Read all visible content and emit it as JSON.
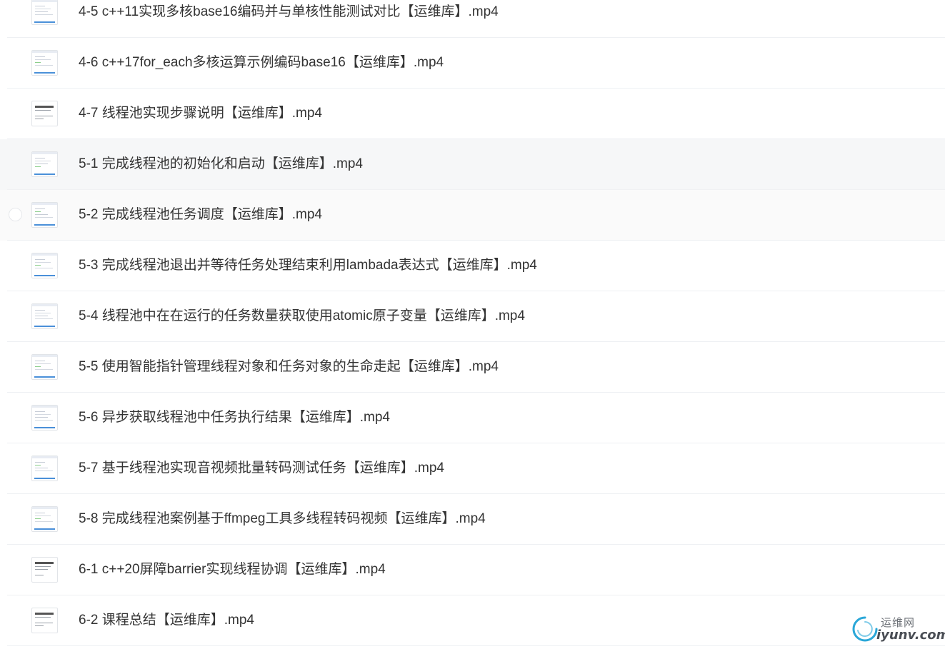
{
  "files": [
    {
      "name": "4-5 c++11实现多核base16编码并与单核性能测试对比【运维库】.mp4",
      "thumb": "code-icon"
    },
    {
      "name": "4-6 c++17for_each多核运算示例编码base16【运维库】.mp4",
      "thumb": "code-icon"
    },
    {
      "name": "4-7 线程池实现步骤说明【运维库】.mp4",
      "thumb": "doc-icon"
    },
    {
      "name": "5-1 完成线程池的初始化和启动【运维库】.mp4",
      "thumb": "code-icon"
    },
    {
      "name": "5-2 完成线程池任务调度【运维库】.mp4",
      "thumb": "code-icon"
    },
    {
      "name": "5-3 完成线程池退出并等待任务处理结束利用lambada表达式【运维库】.mp4",
      "thumb": "code-icon"
    },
    {
      "name": "5-4 线程池中在在运行的任务数量获取使用atomic原子变量【运维库】.mp4",
      "thumb": "code-icon"
    },
    {
      "name": "5-5 使用智能指针管理线程对象和任务对象的生命走起【运维库】.mp4",
      "thumb": "code-icon"
    },
    {
      "name": "5-6 异步获取线程池中任务执行结果【运维库】.mp4",
      "thumb": "code-icon"
    },
    {
      "name": "5-7 基于线程池实现音视频批量转码测试任务【运维库】.mp4",
      "thumb": "code-icon"
    },
    {
      "name": "5-8 完成线程池案例基于ffmpeg工具多线程转码视频【运维库】.mp4",
      "thumb": "code-icon"
    },
    {
      "name": "6-1 c++20屏障barrier实现线程协调【运维库】.mp4",
      "thumb": "doc-icon"
    },
    {
      "name": "6-2 课程总结【运维库】.mp4",
      "thumb": "doc-icon"
    }
  ],
  "watermark": {
    "cn": "运维网",
    "en": "iyunv.com",
    "colors": {
      "ring": "#2aa7d8",
      "text": "#4a4e55"
    }
  },
  "colors": {
    "text": "#333333",
    "divider": "#eef0f3",
    "hover": "#f6f7f8",
    "progress_blue": "#4a90d9"
  }
}
